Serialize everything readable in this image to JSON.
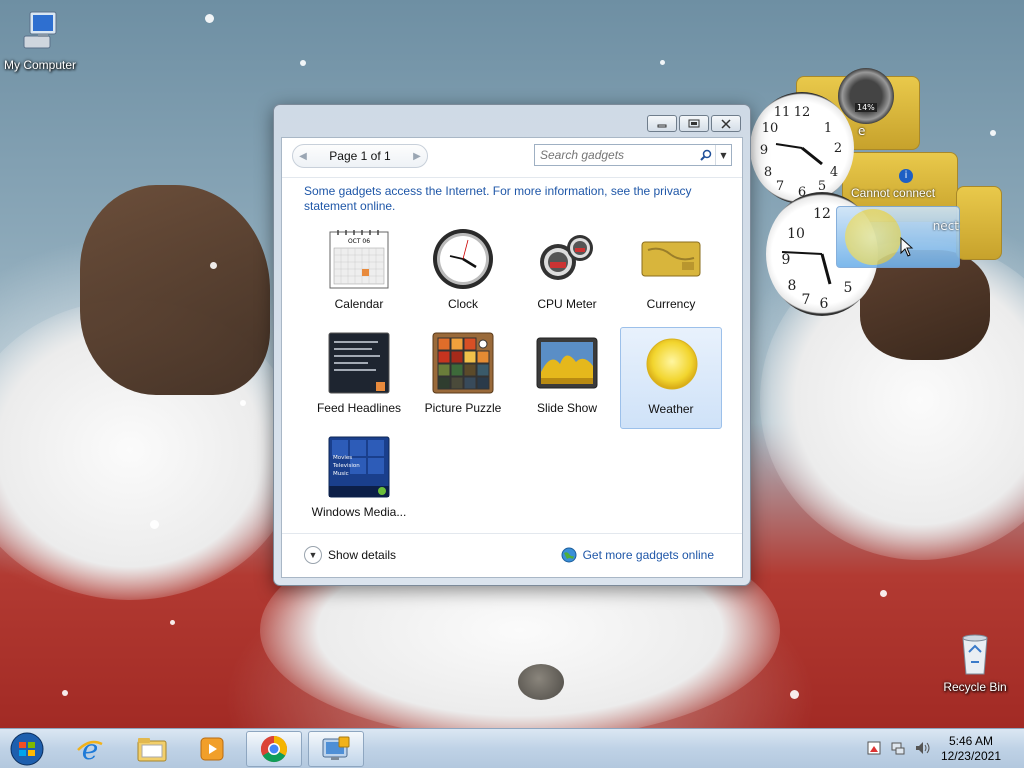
{
  "desktop": {
    "icons": [
      {
        "label": "My Computer",
        "icon": "computer-icon"
      },
      {
        "label": "Recycle Bin",
        "icon": "recycle-bin-icon"
      }
    ]
  },
  "gadget_window": {
    "pager_text": "Page 1 of 1",
    "search_placeholder": "Search gadgets",
    "notice": "Some gadgets access the Internet.  For more information, see the privacy statement online.",
    "gadgets": [
      {
        "label": "Calendar",
        "icon": "calendar-icon"
      },
      {
        "label": "Clock",
        "icon": "clock-icon"
      },
      {
        "label": "CPU Meter",
        "icon": "cpu-meter-icon"
      },
      {
        "label": "Currency",
        "icon": "currency-icon"
      },
      {
        "label": "Feed Headlines",
        "icon": "feed-headlines-icon"
      },
      {
        "label": "Picture Puzzle",
        "icon": "picture-puzzle-icon"
      },
      {
        "label": "Slide Show",
        "icon": "slide-show-icon"
      },
      {
        "label": "Weather",
        "icon": "weather-icon",
        "selected": true
      },
      {
        "label": "Windows Media...",
        "icon": "windows-media-center-icon"
      }
    ],
    "calendar_month": "OCT 06",
    "media_center_menu": [
      "Movies",
      "Television",
      "Music"
    ],
    "show_details": "Show details",
    "get_more": "Get more gadgets online"
  },
  "desktop_gadgets": {
    "cpu_percent": "14%",
    "cannot_connect": "Cannot connect",
    "cannot_connect_partial": "nect",
    "cut_text_1": "e",
    "cut_text_2": "nect"
  },
  "taskbar": {
    "time": "5:46 AM",
    "date": "12/23/2021",
    "pinned": [
      "start-orb-icon",
      "internet-explorer-icon",
      "file-explorer-icon",
      "media-player-icon",
      "chrome-icon",
      "desktop-gadgets-icon"
    ]
  },
  "colors": {
    "link_blue": "#1f57a8",
    "selection_blue": "#cfe2f8",
    "currency_gold": "#d8b53c"
  }
}
